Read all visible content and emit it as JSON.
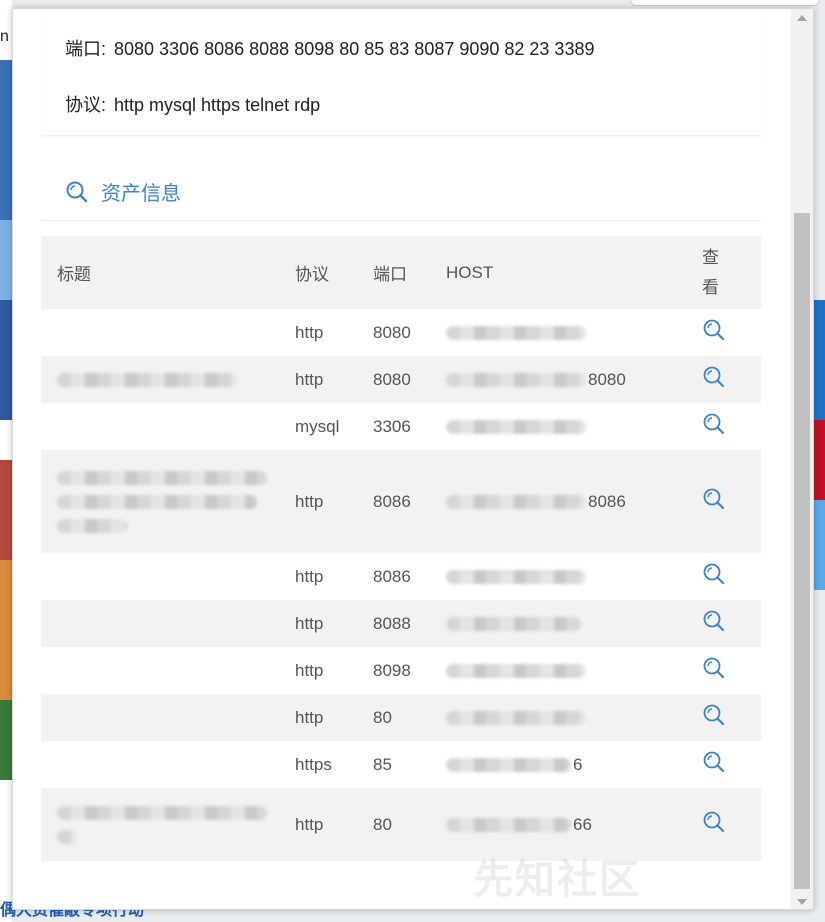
{
  "background": {
    "left_fragment_text": "n",
    "bottom_fragment_text": "偶大资催敲专项行动"
  },
  "port_info": {
    "ports_label": "端口:",
    "ports_value": "8080 3306 8086 8088 8098 80 85 83 8087 9090 82 23 3389",
    "protocols_label": "协议:",
    "protocols_value": "http mysql https telnet rdp"
  },
  "asset_section": {
    "title": "资产信息",
    "icon": "search-icon",
    "accent_color": "#3c83c9"
  },
  "table": {
    "headers": {
      "title": "标题",
      "protocol": "协议",
      "port": "端口",
      "host": "HOST",
      "view": "查看"
    },
    "rows": [
      {
        "protocol": "http",
        "port": "8080",
        "host_suffix": ""
      },
      {
        "protocol": "http",
        "port": "8080",
        "host_suffix": "8080"
      },
      {
        "protocol": "mysql",
        "port": "3306",
        "host_suffix": ""
      },
      {
        "protocol": "http",
        "port": "8086",
        "host_suffix": "8086"
      },
      {
        "protocol": "http",
        "port": "8086",
        "host_suffix": ""
      },
      {
        "protocol": "http",
        "port": "8088",
        "host_suffix": ""
      },
      {
        "protocol": "http",
        "port": "8098",
        "host_suffix": ""
      },
      {
        "protocol": "http",
        "port": "80",
        "host_suffix": ""
      },
      {
        "protocol": "https",
        "port": "85",
        "host_suffix": "6"
      },
      {
        "protocol": "http",
        "port": "80",
        "host_suffix": "66"
      }
    ]
  },
  "watermark": "先知社区"
}
